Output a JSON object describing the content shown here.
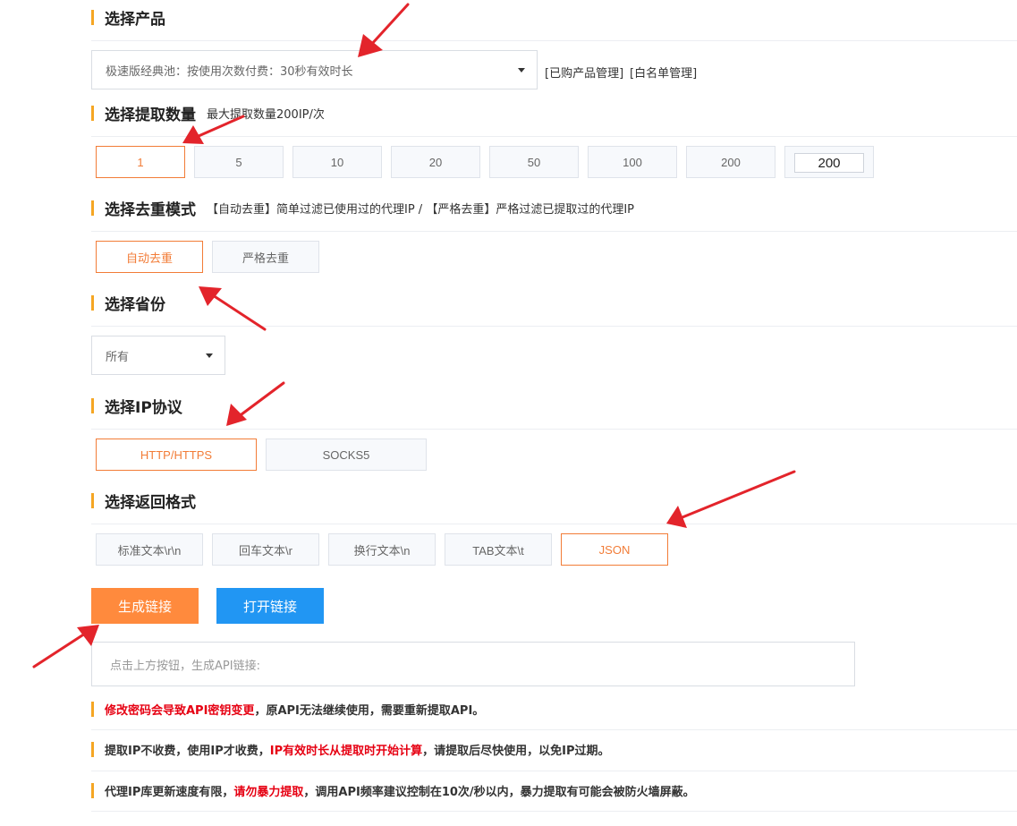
{
  "sections": {
    "product": {
      "title": "选择产品"
    },
    "quantity": {
      "title": "选择提取数量",
      "hint": "最大提取数量200IP/次"
    },
    "dedupe": {
      "title": "选择去重模式",
      "hint": "【自动去重】简单过滤已使用过的代理IP  /  【严格去重】严格过滤已提取过的代理IP"
    },
    "province": {
      "title": "选择省份"
    },
    "protocol": {
      "title": "选择IP协议"
    },
    "format": {
      "title": "选择返回格式"
    }
  },
  "product": {
    "selected": "极速版经典池：按使用次数付费：30秒有效时长",
    "links": [
      "[已购产品管理]",
      "[白名单管理]"
    ]
  },
  "quantity": {
    "options": [
      "1",
      "5",
      "10",
      "20",
      "50",
      "100",
      "200"
    ],
    "selected": "1",
    "custom_value": "200"
  },
  "dedupe": {
    "options": [
      "自动去重",
      "严格去重"
    ],
    "selected": "自动去重"
  },
  "province": {
    "selected": "所有"
  },
  "protocol": {
    "options": [
      "HTTP/HTTPS",
      "SOCKS5"
    ],
    "selected": "HTTP/HTTPS"
  },
  "format": {
    "options": [
      "标准文本\\r\\n",
      "回车文本\\r",
      "换行文本\\n",
      "TAB文本\\t",
      "JSON"
    ],
    "selected": "JSON"
  },
  "actions": {
    "generate_label": "生成链接",
    "open_label": "打开链接",
    "generate_color": "#ff8a3d",
    "open_color": "#2196f3"
  },
  "result": {
    "placeholder": "点击上方按钮，生成API链接:"
  },
  "notes": [
    {
      "red": "修改密码会导致API密钥变更",
      "rest": "，原API无法继续使用，需要重新提取API。"
    },
    {
      "pre": "提取IP不收费，使用IP才收费，",
      "red": "IP有效时长从提取时开始计算",
      "rest": "，请提取后尽快使用，以免IP过期。"
    },
    {
      "pre": "代理IP库更新速度有限，",
      "red": "请勿暴力提取",
      "rest": "，调用API频率建议控制在10次/秒以内，暴力提取有可能会被防火墙屏蔽。"
    }
  ],
  "colors": {
    "accent_orange": "#f27c37",
    "section_bar": "#f5a623",
    "warning_red": "#e60012",
    "annotation_arrow": "#e3242b"
  }
}
